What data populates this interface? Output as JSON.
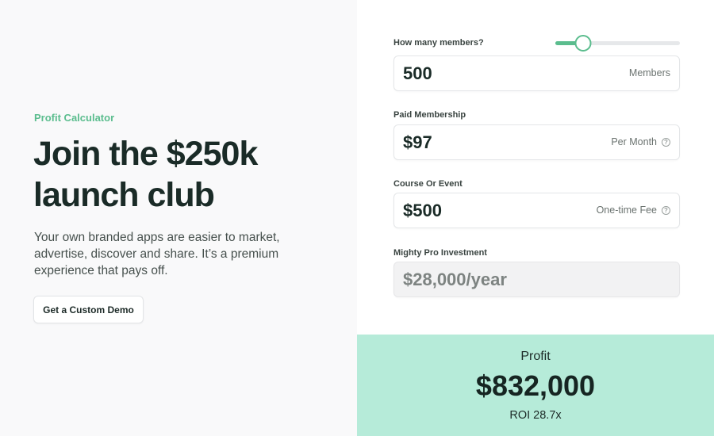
{
  "hero": {
    "eyebrow": "Profit Calculator",
    "headline_line1": "Join the $250k",
    "headline_line2": "launch club",
    "description": "Your own branded apps are easier to market, advertise, discover and share. It’s a premium experience that pays off.",
    "cta_label": "Get a Custom Demo"
  },
  "calculator": {
    "members": {
      "label": "How many members?",
      "value": "500",
      "unit": "Members",
      "slider_fraction": 0.22
    },
    "membership": {
      "label": "Paid Membership",
      "value": "$97",
      "unit": "Per Month",
      "help_icon": "question-circle-icon"
    },
    "course": {
      "label": "Course Or Event",
      "value": "$500",
      "unit": "One-time Fee",
      "help_icon": "question-circle-icon"
    },
    "investment": {
      "label": "Mighty Pro Investment",
      "value": "$28,000/year"
    }
  },
  "result": {
    "label": "Profit",
    "value": "$832,000",
    "roi": "ROI 28.7x"
  },
  "colors": {
    "accent": "#5bbd8e",
    "result_bg": "#b6ebd9",
    "left_bg": "#f9f9fa"
  }
}
